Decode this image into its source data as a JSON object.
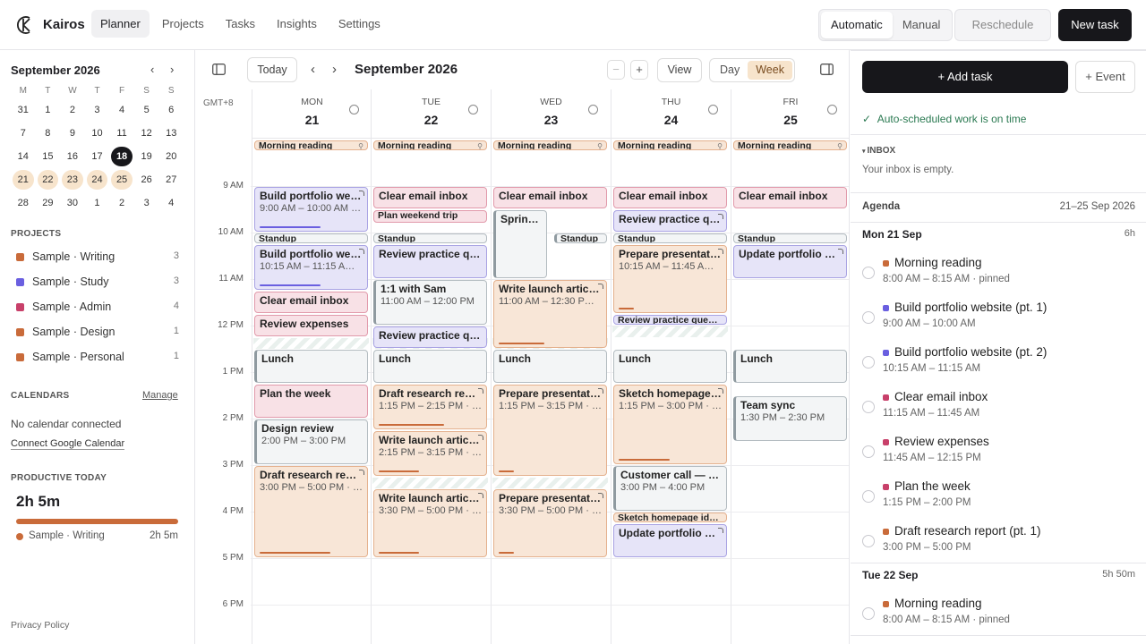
{
  "app": {
    "name": "Kairos"
  },
  "nav": [
    {
      "label": "Planner",
      "active": true
    },
    {
      "label": "Projects"
    },
    {
      "label": "Tasks"
    },
    {
      "label": "Insights"
    },
    {
      "label": "Settings"
    }
  ],
  "mode": {
    "automatic": "Automatic",
    "manual": "Manual",
    "selected": "Automatic"
  },
  "actions": {
    "reschedule": "Reschedule",
    "new_task": "New task"
  },
  "mini_calendar": {
    "title": "September 2026",
    "dow": [
      "M",
      "T",
      "W",
      "T",
      "F",
      "S",
      "S"
    ],
    "weeks": [
      [
        "31",
        "1",
        "2",
        "3",
        "4",
        "5",
        "6"
      ],
      [
        "7",
        "8",
        "9",
        "10",
        "11",
        "12",
        "13"
      ],
      [
        "14",
        "15",
        "16",
        "17",
        "18",
        "19",
        "20"
      ],
      [
        "21",
        "22",
        "23",
        "24",
        "25",
        "26",
        "27"
      ],
      [
        "28",
        "29",
        "30",
        "1",
        "2",
        "3",
        "4"
      ]
    ],
    "today": "18",
    "selected_week_row": 3
  },
  "projects": {
    "heading": "PROJECTS",
    "items": [
      {
        "name": "Sample · Writing",
        "count": "3",
        "color": "#c96b3a"
      },
      {
        "name": "Sample · Study",
        "count": "3",
        "color": "#6a5fe0"
      },
      {
        "name": "Sample · Admin",
        "count": "4",
        "color": "#c8406a"
      },
      {
        "name": "Sample · Design",
        "count": "1",
        "color": "#c96b3a"
      },
      {
        "name": "Sample · Personal",
        "count": "1",
        "color": "#c96b3a"
      }
    ]
  },
  "calendars": {
    "heading": "CALENDARS",
    "manage": "Manage",
    "empty": "No calendar connected",
    "connect": "Connect Google Calendar"
  },
  "productive": {
    "heading": "PRODUCTIVE TODAY",
    "total": "2h 5m",
    "rows": [
      {
        "name": "Sample · Writing",
        "value": "2h 5m"
      }
    ]
  },
  "footer": {
    "privacy": "Privacy Policy"
  },
  "calendar": {
    "today": "Today",
    "title": "September 2026",
    "zoom_out": "−",
    "zoom_in": "+",
    "view": "View",
    "day": "Day",
    "week": "Week",
    "timezone": "GMT+8",
    "days": [
      {
        "name": "MON",
        "date": "21"
      },
      {
        "name": "TUE",
        "date": "22"
      },
      {
        "name": "WED",
        "date": "23"
      },
      {
        "name": "THU",
        "date": "24"
      },
      {
        "name": "FRI",
        "date": "25"
      }
    ],
    "hours": [
      "9 AM",
      "10 AM",
      "11 AM",
      "12 PM",
      "1 PM",
      "2 PM",
      "3 PM",
      "4 PM",
      "5 PM",
      "6 PM"
    ],
    "events": [
      {
        "day": 0,
        "title": "Morning reading",
        "kind": "wr",
        "start": 8.0,
        "end": 8.25,
        "pinned": true
      },
      {
        "day": 0,
        "title": "Build portfolio we…",
        "sub": "9:00 AM – 10:00 AM ·…",
        "kind": "st",
        "start": 9.0,
        "end": 10.0,
        "progress": 0.6,
        "corner": true
      },
      {
        "day": 0,
        "title": "Standup",
        "kind": "gr",
        "start": 10.0,
        "end": 10.25
      },
      {
        "day": 0,
        "title": "Build portfolio we…",
        "sub": "10:15 AM – 11:15 A…",
        "kind": "st",
        "start": 10.25,
        "end": 11.25,
        "progress": 0.6,
        "corner": true
      },
      {
        "day": 0,
        "title": "Clear email inbox",
        "kind": "ad",
        "start": 11.25,
        "end": 11.75
      },
      {
        "day": 0,
        "title": "Review expenses",
        "kind": "ad",
        "start": 11.75,
        "end": 12.25
      },
      {
        "day": 0,
        "title": "Lunch",
        "kind": "gr",
        "bl": true,
        "start": 12.5,
        "end": 13.25
      },
      {
        "day": 0,
        "title": "Plan the week",
        "kind": "ad",
        "start": 13.25,
        "end": 14.0
      },
      {
        "day": 0,
        "title": "Design review",
        "sub": "2:00 PM – 3:00 PM",
        "kind": "gr",
        "bl": true,
        "start": 14.0,
        "end": 15.0
      },
      {
        "day": 0,
        "title": "Draft research rep…",
        "sub": "3:00 PM – 5:00 PM · 2…",
        "kind": "wr",
        "start": 15.0,
        "end": 17.0,
        "progress": 0.7,
        "corner": true
      },
      {
        "day": 1,
        "title": "Morning reading",
        "kind": "wr",
        "start": 8.0,
        "end": 8.25,
        "pinned": true
      },
      {
        "day": 1,
        "title": "Clear email inbox",
        "kind": "ad",
        "start": 9.0,
        "end": 9.5
      },
      {
        "day": 1,
        "title": "Plan weekend trip",
        "kind": "ad",
        "start": 9.5,
        "end": 9.8
      },
      {
        "day": 1,
        "title": "Standup",
        "kind": "gr",
        "start": 10.0,
        "end": 10.25
      },
      {
        "day": 1,
        "title": "Review practice qu…",
        "kind": "st",
        "start": 10.25,
        "end": 11.0
      },
      {
        "day": 1,
        "title": "1:1 with Sam",
        "sub": "11:00 AM – 12:00 PM",
        "kind": "gr",
        "bl": true,
        "start": 11.0,
        "end": 12.0
      },
      {
        "day": 1,
        "title": "Review practice qu…",
        "kind": "st",
        "start": 12.0,
        "end": 12.5
      },
      {
        "day": 1,
        "title": "Lunch",
        "kind": "gr",
        "start": 12.5,
        "end": 13.25
      },
      {
        "day": 1,
        "title": "Draft research rep…",
        "sub": "1:15 PM – 2:15 PM · 2…",
        "kind": "wr",
        "start": 13.25,
        "end": 14.25,
        "progress": 0.65,
        "corner": true
      },
      {
        "day": 1,
        "title": "Write launch articl…",
        "sub": "2:15 PM – 3:15 PM · 1…",
        "kind": "wr",
        "start": 14.25,
        "end": 15.25,
        "progress": 0.4,
        "corner": true
      },
      {
        "day": 1,
        "title": "Write launch articl…",
        "sub": "3:30 PM – 5:00 PM · 1…",
        "kind": "wr",
        "start": 15.5,
        "end": 17.0,
        "progress": 0.4,
        "corner": true
      },
      {
        "day": 2,
        "title": "Morning reading",
        "kind": "wr",
        "start": 8.0,
        "end": 8.25,
        "pinned": true
      },
      {
        "day": 2,
        "title": "Clear email inbox",
        "kind": "ad",
        "start": 9.0,
        "end": 9.5
      },
      {
        "day": 2,
        "title": "Sprint …",
        "kind": "gr",
        "bl": true,
        "start": 9.5,
        "end": 11.0,
        "half": "left"
      },
      {
        "day": 2,
        "title": "Standup",
        "kind": "gr",
        "bl": true,
        "start": 10.0,
        "end": 10.25,
        "half": "right"
      },
      {
        "day": 2,
        "title": "Write launch articl…",
        "sub": "11:00 AM – 12:30 P…",
        "kind": "wr",
        "start": 11.0,
        "end": 12.5,
        "progress": 0.45,
        "corner": true
      },
      {
        "day": 2,
        "title": "Lunch",
        "kind": "gr",
        "start": 12.5,
        "end": 13.25
      },
      {
        "day": 2,
        "title": "Prepare presentati…",
        "sub": "1:15 PM – 3:15 PM · 5…",
        "kind": "wr",
        "start": 13.25,
        "end": 15.25,
        "progress": 0.15,
        "corner": true
      },
      {
        "day": 2,
        "title": "Prepare presentati…",
        "sub": "3:30 PM – 5:00 PM · 5…",
        "kind": "wr",
        "start": 15.5,
        "end": 17.0,
        "progress": 0.15,
        "corner": true
      },
      {
        "day": 3,
        "title": "Morning reading",
        "kind": "wr",
        "start": 8.0,
        "end": 8.25,
        "pinned": true
      },
      {
        "day": 3,
        "title": "Clear email inbox",
        "kind": "ad",
        "start": 9.0,
        "end": 9.5
      },
      {
        "day": 3,
        "title": "Review practice qu…",
        "kind": "st",
        "start": 9.5,
        "end": 10.0,
        "corner": true
      },
      {
        "day": 3,
        "title": "Standup",
        "kind": "gr",
        "start": 10.0,
        "end": 10.25
      },
      {
        "day": 3,
        "title": "Prepare presentati…",
        "sub": "10:15 AM – 11:45 A…",
        "kind": "wr",
        "start": 10.25,
        "end": 11.75,
        "progress": 0.15,
        "corner": true
      },
      {
        "day": 3,
        "title": "Review practice questi…",
        "kind": "st",
        "start": 11.75,
        "end": 12.0,
        "small": true
      },
      {
        "day": 3,
        "title": "Lunch",
        "kind": "gr",
        "start": 12.5,
        "end": 13.25
      },
      {
        "day": 3,
        "title": "Sketch homepage …",
        "sub": "1:15 PM – 3:00 PM · 1…",
        "kind": "wr",
        "start": 13.25,
        "end": 15.0,
        "progress": 0.5,
        "corner": true
      },
      {
        "day": 3,
        "title": "Customer call — N…",
        "sub": "3:00 PM – 4:00 PM",
        "kind": "gr",
        "bl": true,
        "start": 15.0,
        "end": 16.0
      },
      {
        "day": 3,
        "title": "Sketch homepage ide…",
        "kind": "wr",
        "start": 16.0,
        "end": 16.25,
        "small": true
      },
      {
        "day": 3,
        "title": "Update portfolio n…",
        "kind": "st",
        "start": 16.25,
        "end": 17.0,
        "corner": true
      },
      {
        "day": 4,
        "title": "Morning reading",
        "kind": "wr",
        "start": 8.0,
        "end": 8.25,
        "pinned": true
      },
      {
        "day": 4,
        "title": "Clear email inbox",
        "kind": "ad",
        "start": 9.0,
        "end": 9.5
      },
      {
        "day": 4,
        "title": "Standup",
        "kind": "gr",
        "start": 10.0,
        "end": 10.25
      },
      {
        "day": 4,
        "title": "Update portfolio n…",
        "kind": "st",
        "start": 10.25,
        "end": 11.0,
        "corner": true
      },
      {
        "day": 4,
        "title": "Lunch",
        "kind": "gr",
        "bl": true,
        "start": 12.5,
        "end": 13.25
      },
      {
        "day": 4,
        "title": "Team sync",
        "sub": "1:30 PM – 2:30 PM",
        "kind": "gr",
        "bl": true,
        "start": 13.5,
        "end": 14.5
      }
    ]
  },
  "right_panel": {
    "add_task": "+ Add task",
    "add_event": "+ Event",
    "status": "Auto-scheduled work is on time",
    "inbox_heading": "INBOX",
    "inbox_empty": "Your inbox is empty.",
    "agenda_heading": "Agenda",
    "agenda_range": "21–25 Sep 2026",
    "days": [
      {
        "label": "Mon 21 Sep",
        "hours": "6h",
        "items": [
          {
            "title": "Morning reading",
            "time": "8:00 AM – 8:15 AM · pinned",
            "color": "#c96b3a"
          },
          {
            "title": "Build portfolio website (pt. 1)",
            "time": "9:00 AM – 10:00 AM",
            "color": "#6a5fe0"
          },
          {
            "title": "Build portfolio website (pt. 2)",
            "time": "10:15 AM – 11:15 AM",
            "color": "#6a5fe0"
          },
          {
            "title": "Clear email inbox",
            "time": "11:15 AM – 11:45 AM",
            "color": "#c8406a"
          },
          {
            "title": "Review expenses",
            "time": "11:45 AM – 12:15 PM",
            "color": "#c8406a"
          },
          {
            "title": "Plan the week",
            "time": "1:15 PM – 2:00 PM",
            "color": "#c8406a"
          },
          {
            "title": "Draft research report (pt. 1)",
            "time": "3:00 PM – 5:00 PM",
            "color": "#c96b3a"
          }
        ]
      },
      {
        "label": "Tue 22 Sep",
        "hours": "5h 50m",
        "items": [
          {
            "title": "Morning reading",
            "time": "8:00 AM – 8:15 AM · pinned",
            "color": "#c96b3a"
          }
        ]
      }
    ]
  }
}
